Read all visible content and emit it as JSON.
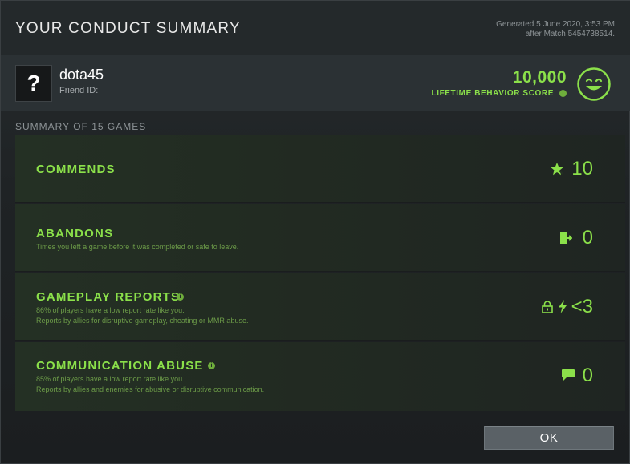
{
  "header": {
    "title": "YOUR CONDUCT SUMMARY",
    "generated_line1": "Generated 5 June 2020, 3:53 PM",
    "generated_line2": "after Match 5454738514."
  },
  "profile": {
    "avatar_glyph": "?",
    "username": "dota45",
    "friend_id_label": "Friend ID:",
    "behavior_score": "10,000",
    "behavior_score_label": "LIFETIME BEHAVIOR SCORE",
    "info_glyph": "i"
  },
  "summary": {
    "heading": "SUMMARY OF 15 GAMES",
    "rows": [
      {
        "title": "COMMENDS",
        "lines": [],
        "value": "10",
        "icon": "star-icon"
      },
      {
        "title": "ABANDONS",
        "lines": [
          "Times you left a game before it was completed or safe to leave."
        ],
        "value": "0",
        "icon": "exit-door-icon"
      },
      {
        "title": "GAMEPLAY REPORTS",
        "lines": [
          "86% of players have a low report rate like you.",
          "Reports by allies for disruptive gameplay, cheating or MMR abuse."
        ],
        "value": "<3",
        "icon": "lightning-icon"
      },
      {
        "title": "COMMUNICATION ABUSE",
        "lines": [
          "85% of players have a low report rate like you.",
          "Reports by allies and enemies for abusive or disruptive communication."
        ],
        "value": "0",
        "icon": "chat-bubble-icon"
      }
    ]
  },
  "footer": {
    "ok_label": "OK"
  },
  "colors": {
    "accent_green": "#8be04a",
    "sub_green": "#6c9b48"
  }
}
